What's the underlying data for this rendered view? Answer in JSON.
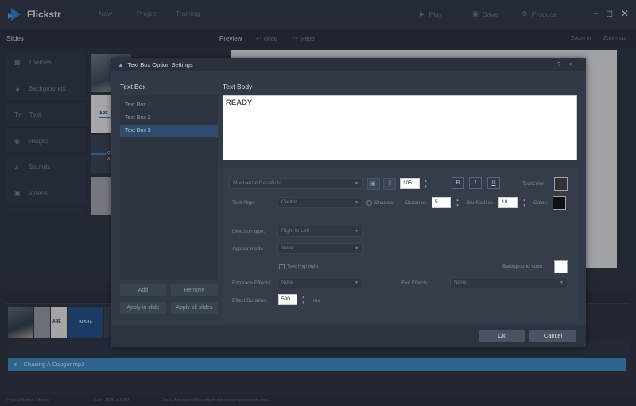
{
  "app": {
    "title": "Flickstr",
    "menu": [
      "New",
      "Project",
      "Training"
    ],
    "toolbar": {
      "play": "Play",
      "save": "Save",
      "produce": "Produce"
    },
    "window": {
      "minimize": "−",
      "maximize": "□",
      "close": "✕"
    },
    "brand_color": "#2f7fd4"
  },
  "subbar": {
    "slides": "Slides",
    "preview": "Preview",
    "undo": "Undo",
    "redo": "Redo",
    "zoom_in": "Zoom in",
    "zoom_out": "Zoom out"
  },
  "sidebar": {
    "items": [
      {
        "label": "Themes",
        "icon": "themes-icon"
      },
      {
        "label": "Backgrounds",
        "icon": "backgrounds-icon"
      },
      {
        "label": "Text",
        "icon": "text-icon",
        "glyph": "Tт"
      },
      {
        "label": "Images",
        "icon": "camera-icon"
      },
      {
        "label": "Sounds",
        "icon": "speaker-icon"
      },
      {
        "label": "Videos",
        "icon": "video-icon"
      }
    ]
  },
  "thumbnails": [
    "ARE",
    "C",
    "X"
  ],
  "timeline": {
    "clips": [
      "ARE",
      "IN SHA"
    ],
    "audio_file": "Chasing A Cougar.mp3"
  },
  "status": {
    "project_name": "Project Name: Fitness",
    "size": "Size: 1920 x 1080",
    "file": "File: L:/Users/test/Desktop/templates/projectsdaph.xmp"
  },
  "dialog": {
    "title": "Text Box Option Settings",
    "help": "?",
    "close": "×",
    "text_box_heading": "Text Box",
    "text_body_heading": "Text Body",
    "text_boxes": [
      "Text Box 1",
      "Text Box 2",
      "Text Box 3"
    ],
    "selected_index": 2,
    "buttons": {
      "add": "Add",
      "remove": "Remove",
      "apply_slide": "Apply in slide",
      "apply_all": "Apply all slides"
    },
    "body_text": "READY",
    "font": "Montserrat ExtraBold",
    "font_size": "105",
    "bold": "B",
    "italic": "I",
    "underline": "U",
    "text_color_label": "TextColor:",
    "text_color": "#333333",
    "text_align_label": "Text Align:",
    "text_align": "Center",
    "shadow_label": "Shadow",
    "distance_label": "Distance:",
    "distance": "5",
    "blur_label": "BlurRadius:",
    "blur": "10",
    "color_label": "Color:",
    "shadow_color": "#111111",
    "direction_label": "Direction type:",
    "direction": "Right to Left",
    "appear_label": "Appear mode:",
    "appear": "None",
    "highlight_label": "Text Highlight",
    "bg_color_label": "Background color:",
    "bg_color": "#ffffff",
    "entrance_label": "Entrance Effects:",
    "entrance": "None",
    "exit_label": "Exit Effects:",
    "exit": "None",
    "duration_label": "Effect Duration:",
    "duration": "500",
    "duration_unit": "ms",
    "ok": "Ok",
    "cancel": "Cancel"
  }
}
